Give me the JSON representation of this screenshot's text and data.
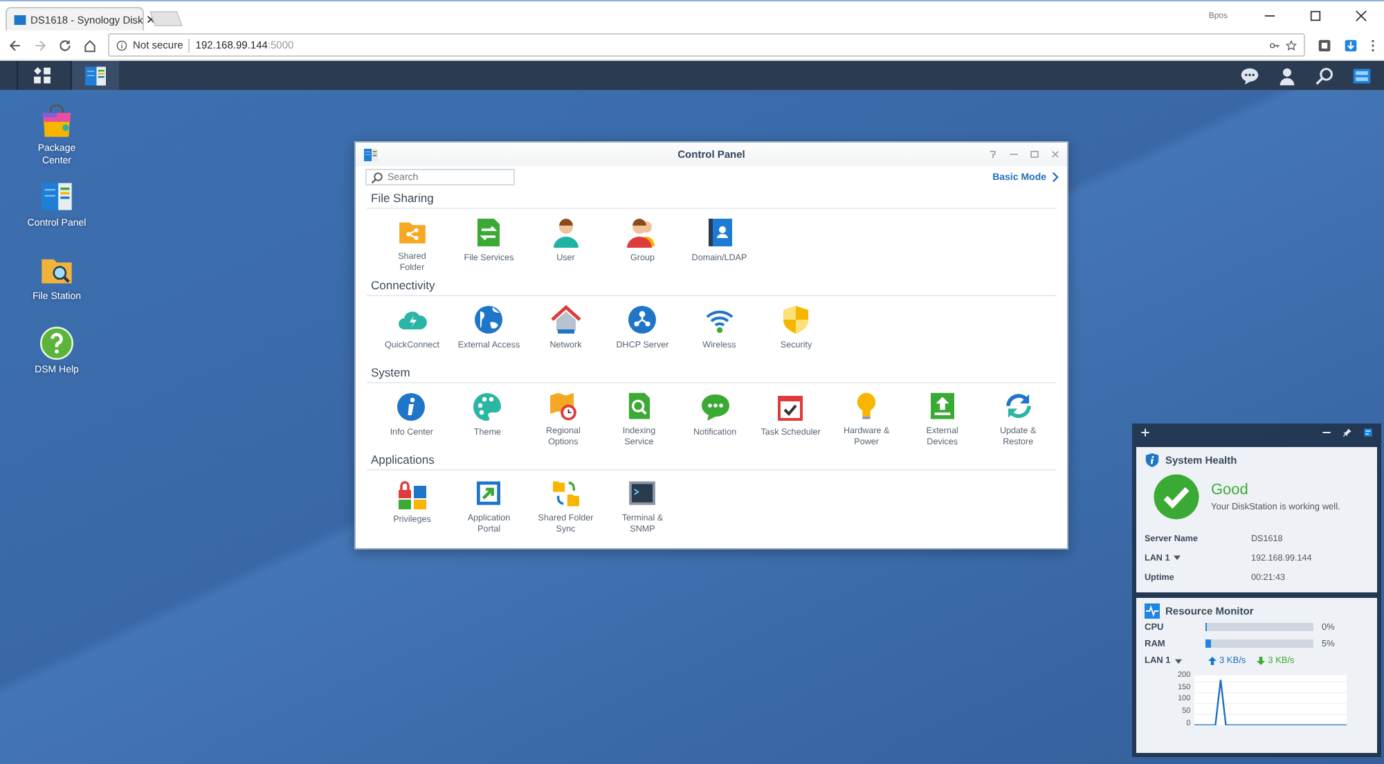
{
  "browser": {
    "tab_title": "DS1618 - Synology Disk",
    "profile": "Bpos",
    "security": "Not secure",
    "url_host": "192.168.99.144",
    "url_port": ":5000"
  },
  "desktop_icons": [
    {
      "label": "Package\nCenter"
    },
    {
      "label": "Control Panel"
    },
    {
      "label": "File Station"
    },
    {
      "label": "DSM Help"
    }
  ],
  "control_panel": {
    "title": "Control Panel",
    "search_placeholder": "Search",
    "basic_mode": "Basic Mode",
    "sections": [
      {
        "title": "File Sharing",
        "items": [
          "Shared\nFolder",
          "File Services",
          "User",
          "Group",
          "Domain/LDAP"
        ]
      },
      {
        "title": "Connectivity",
        "items": [
          "QuickConnect",
          "External Access",
          "Network",
          "DHCP Server",
          "Wireless",
          "Security"
        ]
      },
      {
        "title": "System",
        "items": [
          "Info Center",
          "Theme",
          "Regional\nOptions",
          "Indexing\nService",
          "Notification",
          "Task Scheduler",
          "Hardware &\nPower",
          "External\nDevices",
          "Update &\nRestore"
        ]
      },
      {
        "title": "Applications",
        "items": [
          "Privileges",
          "Application\nPortal",
          "Shared Folder\nSync",
          "Terminal &\nSNMP"
        ]
      }
    ]
  },
  "system_health": {
    "title": "System Health",
    "status": "Good",
    "message": "Your DiskStation is working well.",
    "rows": [
      {
        "label": "Server Name",
        "value": "DS1618",
        "dropdown": false
      },
      {
        "label": "LAN 1",
        "value": "192.168.99.144",
        "dropdown": true
      },
      {
        "label": "Uptime",
        "value": "00:21:43",
        "dropdown": false
      }
    ]
  },
  "resource_monitor": {
    "title": "Resource Monitor",
    "meters": [
      {
        "label": "CPU",
        "level": 0,
        "reading": "0%"
      },
      {
        "label": "RAM",
        "level": 0.05,
        "reading": "5%"
      }
    ],
    "network": {
      "label": "LAN 1",
      "upload": "3 KB/s",
      "download": "3 KB/s"
    },
    "chart_data": {
      "type": "line",
      "yticks": [
        0,
        50,
        100,
        150,
        200
      ],
      "ylim": [
        0,
        230
      ],
      "grid": true,
      "series": [
        {
          "color": "#1f6fc0",
          "values": [
            0,
            0,
            0,
            0,
            0,
            210,
            0,
            0,
            0,
            0,
            0,
            0,
            0,
            0,
            0,
            0,
            0,
            0,
            0,
            0,
            0,
            0,
            0,
            0,
            0,
            0,
            0,
            0,
            0,
            0
          ]
        }
      ]
    }
  }
}
